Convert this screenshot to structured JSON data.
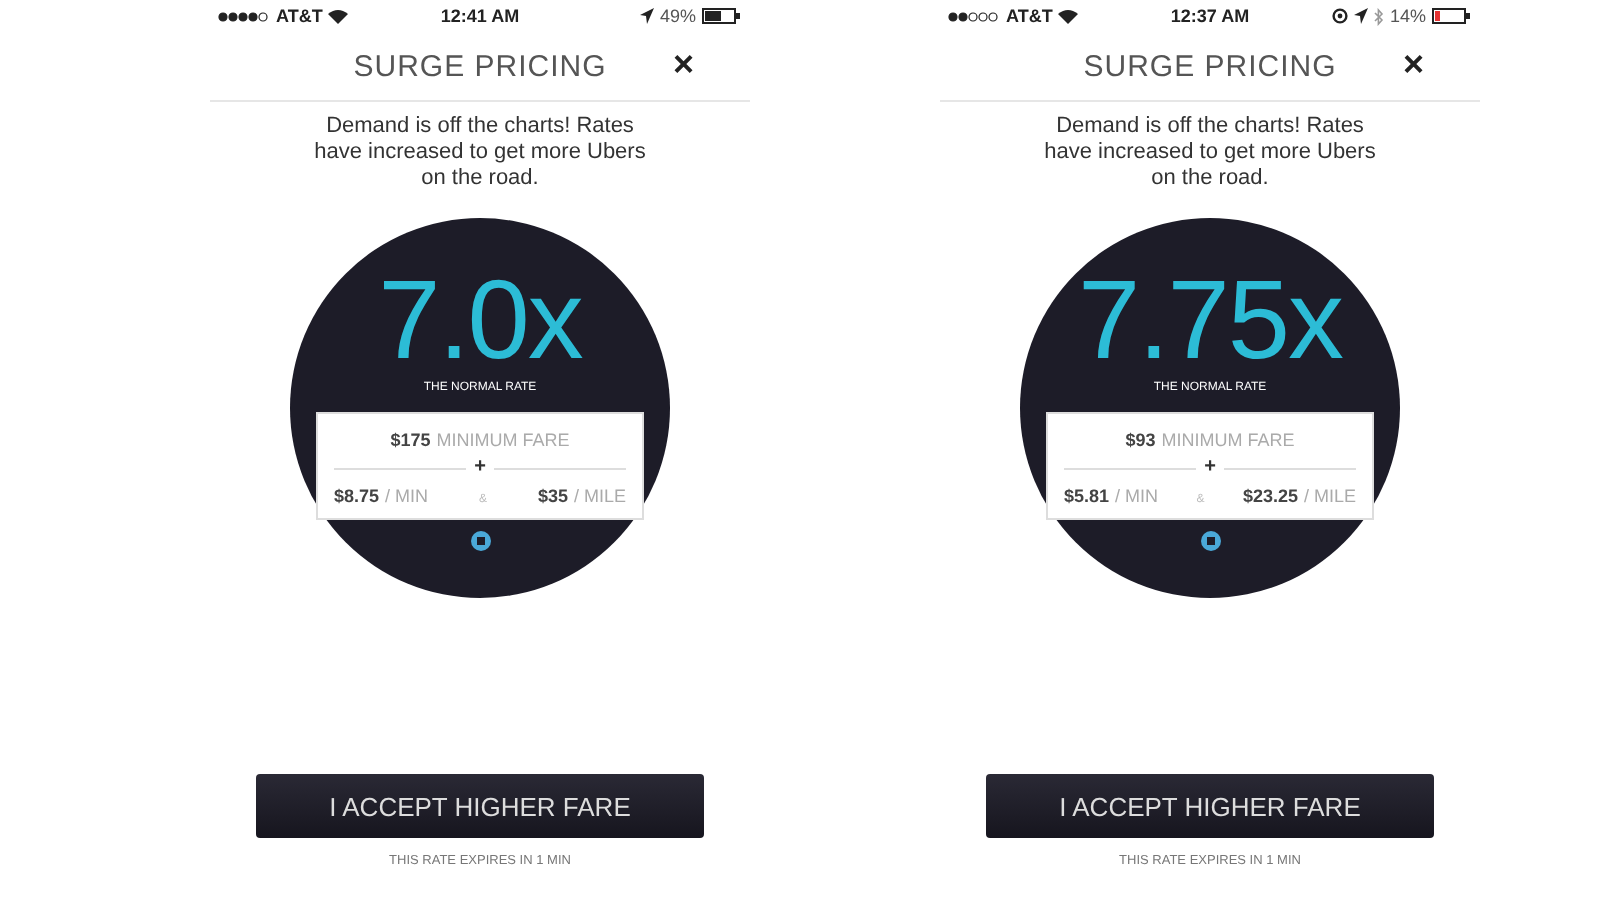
{
  "screens": [
    {
      "status_bar": {
        "carrier": "AT&T",
        "time": "12:41 AM",
        "battery": "49%",
        "battery_low": false,
        "icons": [
          {
            "kind": "location"
          }
        ]
      },
      "title": "SURGE PRICING",
      "close": "×",
      "message": "Demand is off the charts! Rates have increased to get more Ubers on the road.",
      "multiplier": "7.0x",
      "multiplier_caption": "THE NORMAL RATE",
      "minimum_amount": "$175",
      "minimum_label": "MINIMUM FARE",
      "plus": "+",
      "per_min_amount": "$8.75",
      "per_min_label": "/ MIN",
      "ampersand": "&",
      "per_mile_amount": "$35",
      "per_mile_label": "/ MILE",
      "accept_button": "I ACCEPT HIGHER FARE",
      "expiry_note": "THIS RATE EXPIRES IN 1 MIN"
    },
    {
      "status_bar": {
        "carrier": "AT&T",
        "time": "12:37 AM",
        "battery": "14%",
        "battery_low": true,
        "icons": [
          {
            "kind": "alarm"
          },
          {
            "kind": "location"
          },
          {
            "kind": "bluetooth"
          }
        ]
      },
      "title": "SURGE PRICING",
      "close": "×",
      "message": "Demand is off the charts! Rates have increased to get more Ubers on the road.",
      "multiplier": "7.75x",
      "multiplier_caption": "THE NORMAL RATE",
      "minimum_amount": "$93",
      "minimum_label": "MINIMUM FARE",
      "plus": "+",
      "per_min_amount": "$5.81",
      "per_min_label": "/ MIN",
      "ampersand": "&",
      "per_mile_amount": "$23.25",
      "per_mile_label": "/ MILE",
      "accept_button": "I ACCEPT HIGHER FARE",
      "expiry_note": "THIS RATE EXPIRES IN 1 MIN"
    }
  ]
}
